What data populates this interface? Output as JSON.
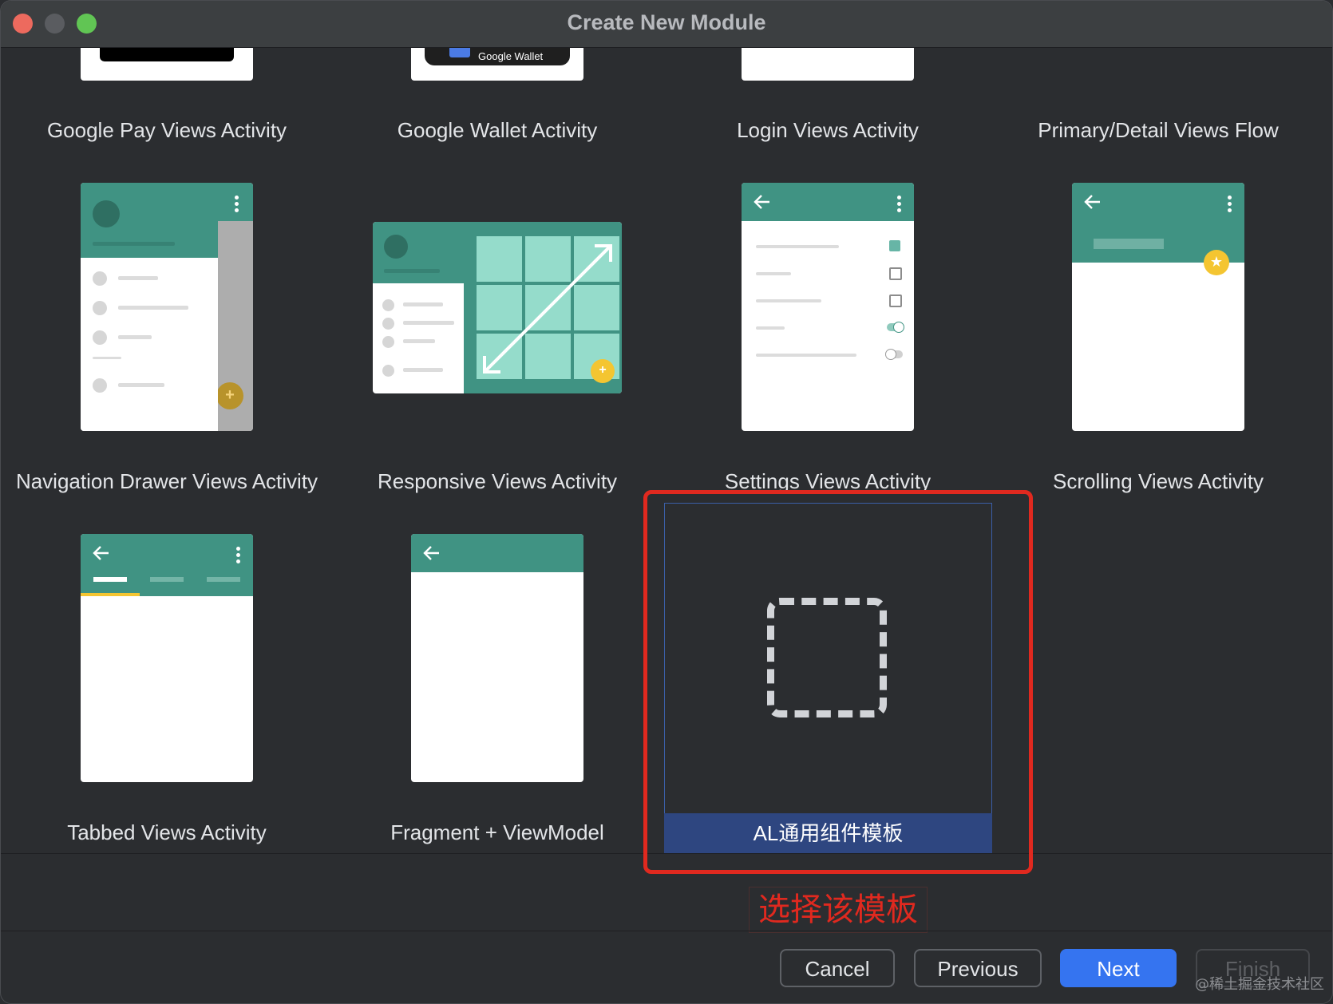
{
  "window": {
    "title": "Create New Module"
  },
  "templates": [
    {
      "name": "Google Pay Views Activity"
    },
    {
      "name": "Google Wallet Activity",
      "badge": "Google Wallet"
    },
    {
      "name": "Login Views Activity"
    },
    {
      "name": "Primary/Detail Views Flow"
    },
    {
      "name": "Navigation Drawer Views Activity"
    },
    {
      "name": "Responsive Views Activity"
    },
    {
      "name": "Settings Views Activity"
    },
    {
      "name": "Scrolling Views Activity"
    },
    {
      "name": "Tabbed Views Activity"
    },
    {
      "name": "Fragment + ViewModel"
    },
    {
      "name": "AL通用组件模板",
      "selected": true
    }
  ],
  "annotation": {
    "text": "选择该模板",
    "color": "#e0291f"
  },
  "buttons": {
    "cancel": "Cancel",
    "previous": "Previous",
    "next": "Next",
    "finish": "Finish"
  },
  "watermark": "@稀土掘金技术社区",
  "colors": {
    "accent": "#3574f0",
    "teal": "#409383",
    "fab": "#f4c531",
    "selection": "#2e4680"
  }
}
